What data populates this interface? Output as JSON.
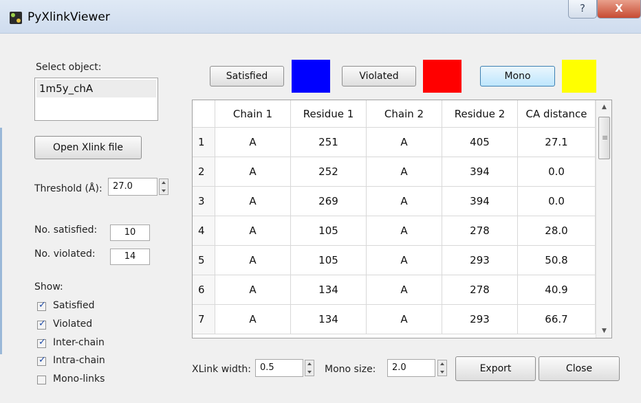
{
  "window": {
    "title": "PyXlinkViewer",
    "help_glyph": "?",
    "close_glyph": "X"
  },
  "left": {
    "select_label": "Select object:",
    "objects": [
      "1m5y_chA"
    ],
    "open_button": "Open Xlink file",
    "threshold_label": "Threshold (Å):",
    "threshold_value": "27.0",
    "satisfied_label": "No. satisfied:",
    "satisfied_value": "10",
    "violated_label": "No. violated:",
    "violated_value": "14",
    "show_label": "Show:",
    "show_options": [
      {
        "label": "Satisfied",
        "checked": true
      },
      {
        "label": "Violated",
        "checked": true
      },
      {
        "label": "Inter-chain",
        "checked": true
      },
      {
        "label": "Intra-chain",
        "checked": true
      },
      {
        "label": "Mono-links",
        "checked": false
      }
    ]
  },
  "colors": {
    "satisfied_button": "Satisfied",
    "satisfied_color": "#0000ff",
    "violated_button": "Violated",
    "violated_color": "#ff0000",
    "mono_button": "Mono",
    "mono_color": "#ffff00"
  },
  "table": {
    "headers": [
      "Chain 1",
      "Residue 1",
      "Chain 2",
      "Residue 2",
      "CA distance"
    ],
    "rows": [
      [
        "1",
        "A",
        "251",
        "A",
        "405",
        "27.1"
      ],
      [
        "2",
        "A",
        "252",
        "A",
        "394",
        "0.0"
      ],
      [
        "3",
        "A",
        "269",
        "A",
        "394",
        "0.0"
      ],
      [
        "4",
        "A",
        "105",
        "A",
        "278",
        "28.0"
      ],
      [
        "5",
        "A",
        "105",
        "A",
        "293",
        "50.8"
      ],
      [
        "6",
        "A",
        "134",
        "A",
        "278",
        "40.9"
      ],
      [
        "7",
        "A",
        "134",
        "A",
        "293",
        "66.7"
      ]
    ]
  },
  "bottom": {
    "xlink_width_label": "XLink width:",
    "xlink_width_value": "0.5",
    "mono_size_label": "Mono size:",
    "mono_size_value": "2.0",
    "export_button": "Export",
    "close_button": "Close"
  }
}
